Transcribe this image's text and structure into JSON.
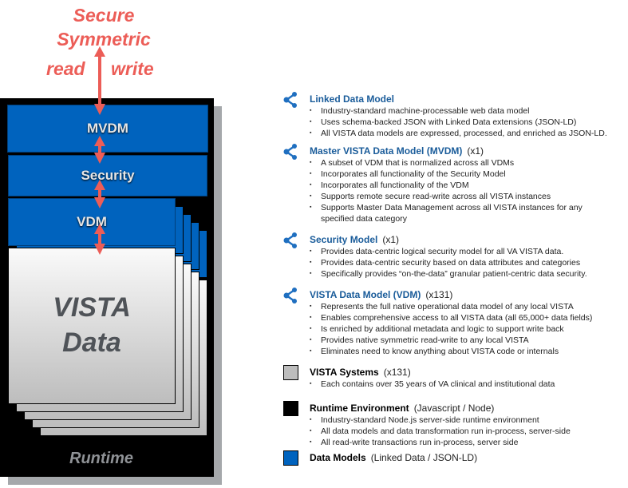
{
  "diagram": {
    "top_label": [
      "Secure",
      "Symmetric"
    ],
    "read_label": "read",
    "write_label": "write",
    "mvdm_label": "MVDM",
    "security_label": "Security",
    "vdm_label": "VDM",
    "vista_data_label": [
      "VISTA",
      "Data"
    ],
    "runtime_label": "Runtime",
    "colors": {
      "arrow": "#ec5d57",
      "blue": "#0063be",
      "black": "#000000",
      "gray": "#bdbdbd"
    }
  },
  "legend": [
    {
      "icon": "share-network-icon",
      "title": "Linked Data Model",
      "suffix": "",
      "bullets": [
        "Industry-standard machine-processable web data model",
        "Uses schema-backed JSON with Linked Data extensions (JSON-LD)",
        "All VISTA data models are expressed, processed, and enriched as JSON-LD."
      ]
    },
    {
      "icon": "share-network-icon",
      "title": "Master VISTA Data Model (MVDM)",
      "suffix": "(x1)",
      "bullets": [
        "A subset of VDM that  is normalized across all VDMs",
        "Incorporates all functionality of the Security Model",
        "Incorporates all functionality of the VDM",
        "Supports  remote secure read-write across all VISTA instances",
        "Supports Master Data Management across all VISTA instances for any specified data category"
      ]
    },
    {
      "icon": "share-network-icon",
      "title": "Security Model",
      "suffix": "(x1)",
      "bullets": [
        "Provides  data-centric logical security model for all VA VISTA data.",
        "Provides data-centric security based on data attributes and categories",
        "Specifically provides “on-the-data” granular patient-centric data security."
      ]
    },
    {
      "icon": "share-network-icon",
      "title": "VISTA Data Model (VDM)",
      "suffix": "(x131)",
      "bullets": [
        "Represents the full native operational data model of any local VISTA",
        "Enables comprehensive access to all VISTA data (all 65,000+ data fields)",
        "Is enriched by additional metadata and logic to support write back",
        "Provides native symmetric read-write to any local VISTA",
        "Eliminates need to know anything about VISTA code or internals"
      ]
    },
    {
      "icon": "gray-square-icon",
      "title": "VISTA Systems",
      "suffix": "(x131)",
      "bullets": [
        "Each contains over 35 years of VA clinical and institutional data"
      ]
    },
    {
      "icon": "black-square-icon",
      "title": "Runtime Environment",
      "suffix": "(Javascript / Node)",
      "bullets": [
        "Industry-standard  Node.js server-side runtime environment",
        "All data models and data transformation run in-process, server-side",
        "All  read-write transactions run in-process, server side"
      ]
    },
    {
      "icon": "blue-square-icon",
      "title": "Data Models",
      "suffix": "(Linked Data / JSON-LD)",
      "bullets": []
    }
  ]
}
